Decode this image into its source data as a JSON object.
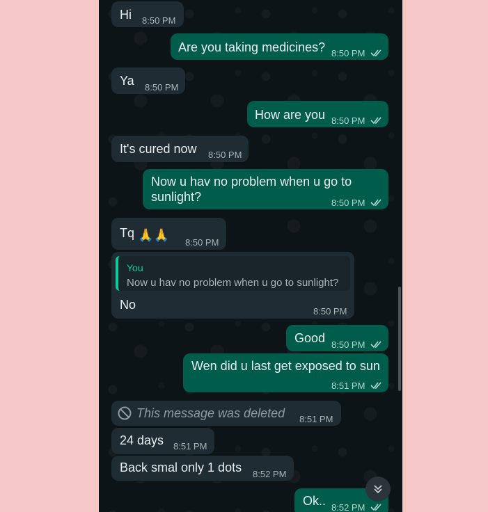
{
  "chat": {
    "messages": [
      {
        "id": "m1",
        "direction": "in",
        "text": "Hi",
        "time": "8:50 PM"
      },
      {
        "id": "m2",
        "direction": "out",
        "text": "Are you taking medicines?",
        "time": "8:50 PM",
        "status": "read"
      },
      {
        "id": "m3",
        "direction": "in",
        "text": "Ya",
        "time": "8:50 PM"
      },
      {
        "id": "m4",
        "direction": "out",
        "text": "How are you",
        "time": "8:50 PM",
        "status": "read"
      },
      {
        "id": "m5",
        "direction": "in",
        "text": "It's cured now",
        "time": "8:50 PM"
      },
      {
        "id": "m6",
        "direction": "out",
        "text_line1": "Now u hav no problem when u go to",
        "text_line2": "sunlight?",
        "time": "8:50 PM",
        "status": "read"
      },
      {
        "id": "m7",
        "direction": "in",
        "text": "Tq",
        "emoji": "🙏🙏",
        "time": "8:50 PM"
      },
      {
        "id": "m8",
        "direction": "in",
        "reply_to": {
          "author": "You",
          "text": "Now u hav no problem when u go to sunlight?"
        },
        "text": "No",
        "time": "8:50 PM"
      },
      {
        "id": "m9",
        "direction": "out",
        "text": "Good",
        "time": "8:50 PM",
        "status": "read"
      },
      {
        "id": "m10",
        "direction": "out",
        "text": "Wen did u last get exposed to sun",
        "time": "8:51 PM",
        "status": "read"
      },
      {
        "id": "m11",
        "direction": "in",
        "deleted": true,
        "text": "This message was deleted",
        "time": "8:51 PM"
      },
      {
        "id": "m12",
        "direction": "in",
        "text": "24 days",
        "time": "8:51 PM"
      },
      {
        "id": "m13",
        "direction": "in",
        "text": "Back smal only 1 dots",
        "time": "8:52 PM"
      },
      {
        "id": "m14",
        "direction": "out",
        "text": "Ok..",
        "time": "8:52 PM",
        "status": "read"
      }
    ]
  },
  "colors": {
    "background": "#0d1418",
    "incoming_bubble": "#1f2c33",
    "outgoing_bubble": "#005c4b",
    "read_ticks": "#b6d6cf",
    "reply_accent": "#06cf9c",
    "page_background": "#f5c7c7"
  },
  "icons": {
    "read_status": "double-check-icon",
    "deleted": "prohibited-icon",
    "scroll_down": "double-chevron-down-icon"
  }
}
